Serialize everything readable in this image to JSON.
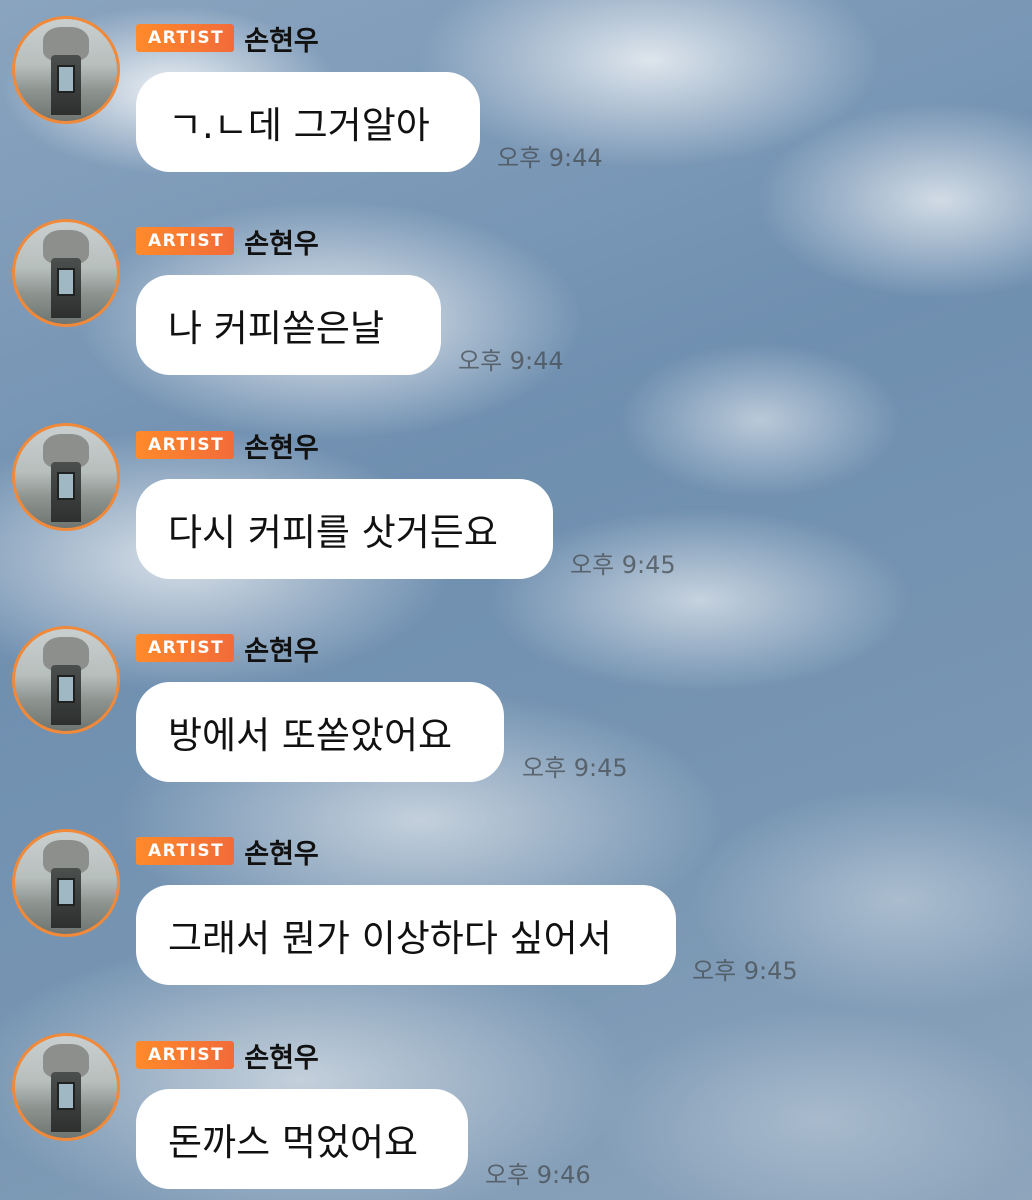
{
  "chat": {
    "badge_label": "ARTIST",
    "badge_color": "#f47a32",
    "avatar_ring_color": "#f08a3a",
    "messages": [
      {
        "sender": "손현우",
        "text": "ㄱ.ㄴ데 그거알아",
        "time": "오후 9:44"
      },
      {
        "sender": "손현우",
        "text": "나 커피쏟은날",
        "time": "오후 9:44"
      },
      {
        "sender": "손현우",
        "text": "다시 커피를 삿거든요",
        "time": "오후 9:45"
      },
      {
        "sender": "손현우",
        "text": "방에서 또쏟았어요",
        "time": "오후 9:45"
      },
      {
        "sender": "손현우",
        "text": "그래서 뭔가 이상하다 싶어서",
        "time": "오후 9:45"
      },
      {
        "sender": "손현우",
        "text": "돈까스 먹었어요",
        "time": "오후 9:46"
      }
    ]
  }
}
